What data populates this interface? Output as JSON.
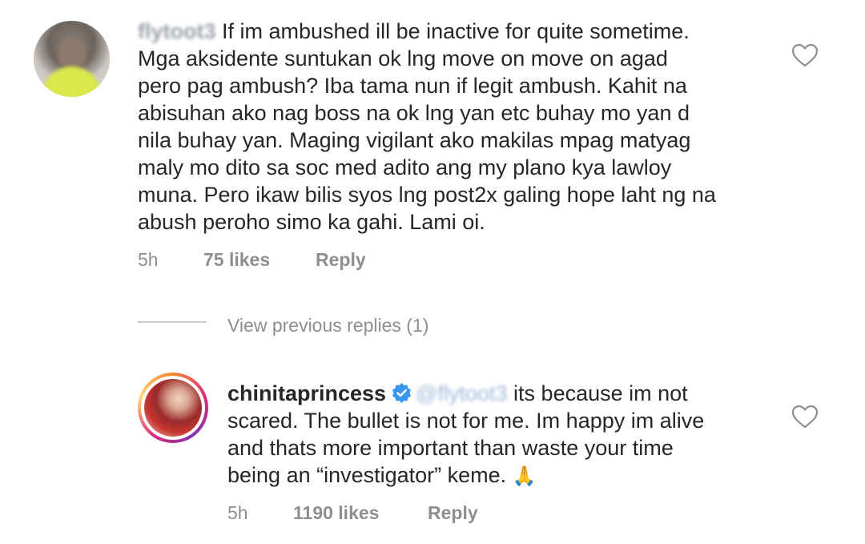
{
  "comment1": {
    "username": "flytoot3",
    "lines": [
      " If im ambushed ill be inactive for quite sometime.",
      "Mga aksidente suntukan ok lng move on move on agad",
      "pero pag ambush? Iba tama nun if legit ambush. Kahit na",
      "abisuhan ako nag boss na ok lng yan etc buhay mo yan d",
      "nila buhay yan. Maging vigilant ako makilas mpag matyag",
      "maly mo dito sa soc med adito ang my plano kya lawloy",
      "muna. Pero ikaw bilis syos lng post2x galing hope laht ng na",
      "abush peroho simo ka gahi. Lami oi."
    ],
    "time": "5h",
    "likes": "75 likes",
    "reply": "Reply"
  },
  "view_replies": "View previous replies (1)",
  "comment2": {
    "username": "chinitaprincess",
    "mention": "@flytoot3",
    "lines": [
      " its because im not",
      "scared. The bullet is not for me. Im happy im alive",
      "and thats more important than waste your time",
      "being an “investigator” keme. "
    ],
    "emoji": "🙏",
    "time": "5h",
    "likes": "1190 likes",
    "reply": "Reply"
  },
  "icons": {
    "like": "heart-outline-icon",
    "verified": "verified-badge-icon"
  },
  "colors": {
    "text": "#262626",
    "meta": "#8e8e8e",
    "verified": "#3897f0"
  }
}
